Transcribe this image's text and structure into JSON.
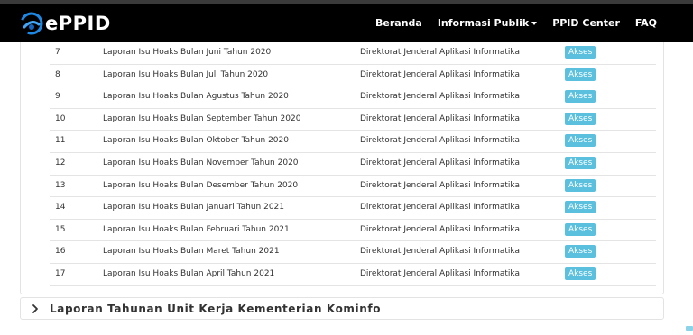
{
  "brand": {
    "name": "ePPID",
    "logo_icon": "eppid-logo-icon"
  },
  "nav": {
    "items": [
      {
        "label": "Beranda"
      },
      {
        "label": "Informasi Publik",
        "dropdown": true
      },
      {
        "label": "PPID Center"
      },
      {
        "label": "FAQ"
      }
    ]
  },
  "table": {
    "rows": [
      {
        "no": "7",
        "title": "Laporan Isu Hoaks Bulan Juni Tahun 2020",
        "unit": "Direktorat Jenderal Aplikasi Informatika",
        "action": "Akses"
      },
      {
        "no": "8",
        "title": "Laporan Isu Hoaks Bulan Juli Tahun 2020",
        "unit": "Direktorat Jenderal Aplikasi Informatika",
        "action": "Akses"
      },
      {
        "no": "9",
        "title": "Laporan Isu Hoaks Bulan Agustus Tahun 2020",
        "unit": "Direktorat Jenderal Aplikasi Informatika",
        "action": "Akses"
      },
      {
        "no": "10",
        "title": "Laporan Isu Hoaks Bulan September Tahun 2020",
        "unit": "Direktorat Jenderal Aplikasi Informatika",
        "action": "Akses"
      },
      {
        "no": "11",
        "title": "Laporan Isu Hoaks Bulan Oktober Tahun 2020",
        "unit": "Direktorat Jenderal Aplikasi Informatika",
        "action": "Akses"
      },
      {
        "no": "12",
        "title": "Laporan Isu Hoaks Bulan November Tahun 2020",
        "unit": "Direktorat Jenderal Aplikasi Informatika",
        "action": "Akses"
      },
      {
        "no": "13",
        "title": "Laporan Isu Hoaks Bulan Desember Tahun 2020",
        "unit": "Direktorat Jenderal Aplikasi Informatika",
        "action": "Akses"
      },
      {
        "no": "14",
        "title": "Laporan Isu Hoaks Bulan Januari Tahun 2021",
        "unit": "Direktorat Jenderal Aplikasi Informatika",
        "action": "Akses"
      },
      {
        "no": "15",
        "title": "Laporan Isu Hoaks Bulan Februari Tahun 2021",
        "unit": "Direktorat Jenderal Aplikasi Informatika",
        "action": "Akses"
      },
      {
        "no": "16",
        "title": "Laporan Isu Hoaks Bulan Maret Tahun 2021",
        "unit": "Direktorat Jenderal Aplikasi Informatika",
        "action": "Akses"
      },
      {
        "no": "17",
        "title": "Laporan Isu Hoaks Bulan April Tahun 2021",
        "unit": "Direktorat Jenderal Aplikasi Informatika",
        "action": "Akses"
      }
    ]
  },
  "accordion": {
    "title": "Laporan Tahunan Unit Kerja Kementerian Kominfo",
    "icon": "chevron-right-icon"
  },
  "colors": {
    "navbar_bg": "#000000",
    "badge_bg": "#5bc0de",
    "logo_blue": "#1e88e5",
    "text": "#333333"
  }
}
